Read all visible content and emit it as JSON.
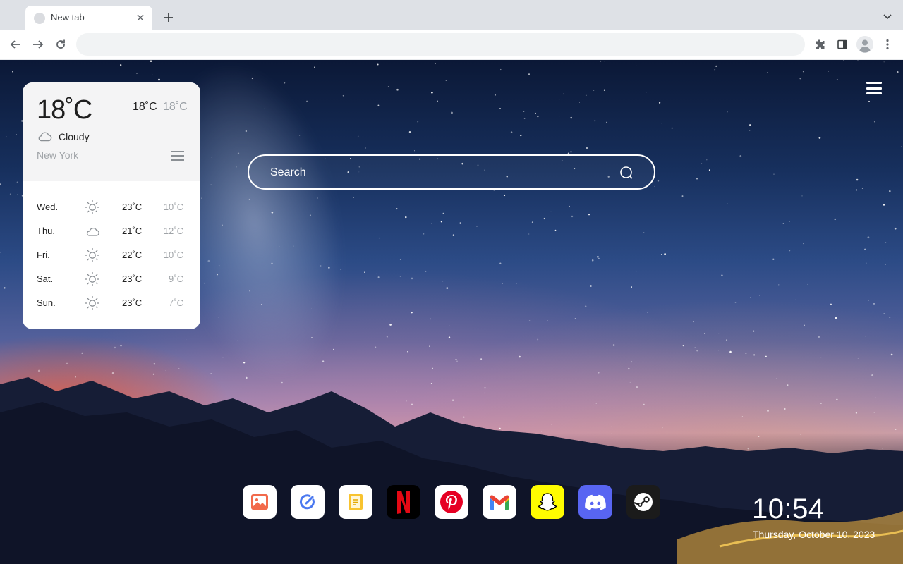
{
  "browser": {
    "tab": {
      "title": "New tab"
    },
    "omnibox": {
      "value": "",
      "placeholder": ""
    },
    "icons": [
      "tab-favicon",
      "close-icon",
      "plus-icon",
      "chevron-down-icon",
      "back-icon",
      "forward-icon",
      "reload-icon",
      "extensions-icon",
      "side-panel-icon",
      "profile-avatar",
      "more-vert-icon"
    ]
  },
  "search": {
    "placeholder": "Search"
  },
  "weather": {
    "current_temp": "18˚C",
    "high": "18˚C",
    "low": "18˚C",
    "condition": "Cloudy",
    "condition_icon": "cloud-icon",
    "city": "New York",
    "forecast": [
      {
        "day": "Wed.",
        "icon": "sun-icon",
        "high": "23˚C",
        "low": "10˚C"
      },
      {
        "day": "Thu.",
        "icon": "cloud-icon",
        "high": "21˚C",
        "low": "12˚C"
      },
      {
        "day": "Fri.",
        "icon": "sun-icon",
        "high": "22˚C",
        "low": "10˚C"
      },
      {
        "day": "Sat.",
        "icon": "sun-icon",
        "high": "23˚C",
        "low": "9˚C"
      },
      {
        "day": "Sun.",
        "icon": "sun-icon",
        "high": "23˚C",
        "low": "7˚C"
      }
    ]
  },
  "dock": {
    "apps": [
      {
        "name": "photos",
        "icon": "photos-icon"
      },
      {
        "name": "edit",
        "icon": "edit-icon"
      },
      {
        "name": "notes",
        "icon": "notes-icon"
      },
      {
        "name": "netflix",
        "icon": "netflix-icon"
      },
      {
        "name": "pinterest",
        "icon": "pinterest-icon"
      },
      {
        "name": "gmail",
        "icon": "gmail-icon"
      },
      {
        "name": "snapchat",
        "icon": "snapchat-icon"
      },
      {
        "name": "discord",
        "icon": "discord-icon"
      },
      {
        "name": "steam",
        "icon": "steam-icon"
      }
    ]
  },
  "clock": {
    "time": "10:54",
    "date": "Thursday, October 10, 2023"
  },
  "colors": {
    "netflix": "#000000",
    "netflix_red": "#e50914",
    "pinterest": "#e60023",
    "snapchat": "#fffc00",
    "discord": "#5865f2",
    "steam": "#1b1b1b"
  }
}
